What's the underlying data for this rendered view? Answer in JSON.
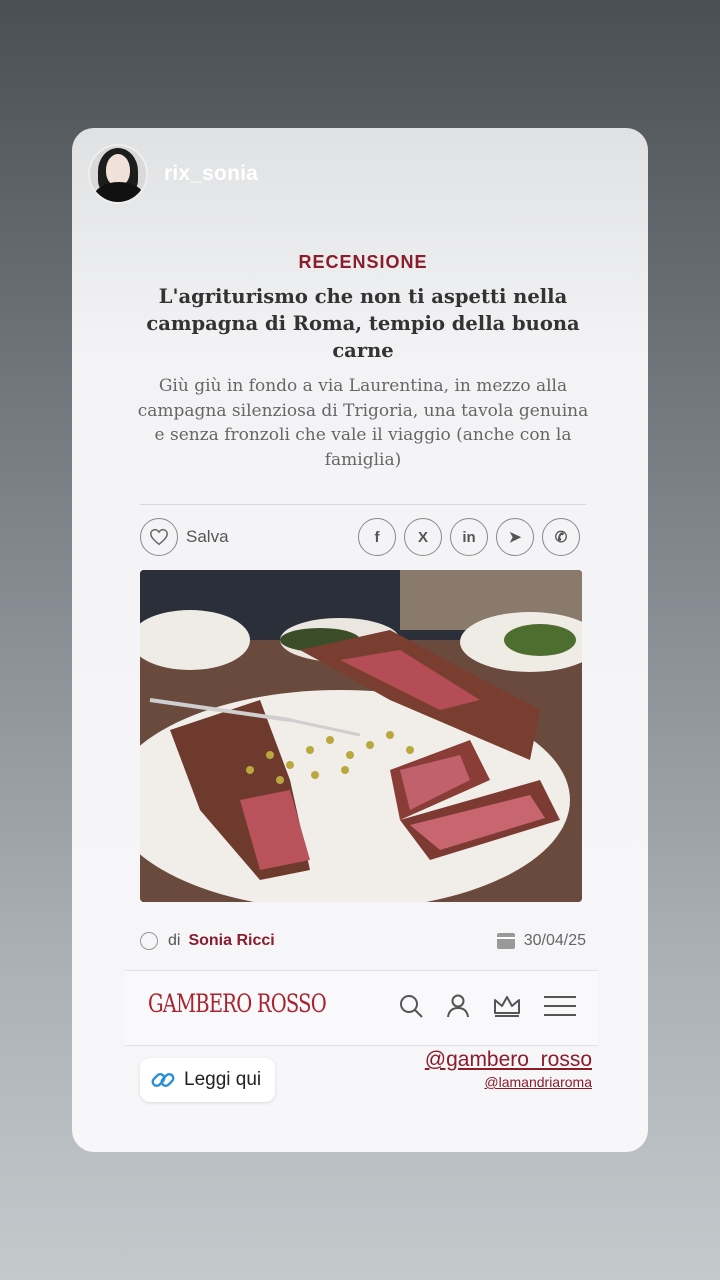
{
  "story": {
    "username": "rix_sonia"
  },
  "article": {
    "kicker": "RECENSIONE",
    "headline": "L'agriturismo che non ti aspetti nella campagna di Roma, tempio della buona carne",
    "subhead": "Giù giù in fondo a via Laurentina, in mezzo alla campagna silenziosa di Trigoria, una tavola genuina e senza fronzoli che vale il viaggio (anche con la famiglia)",
    "save_label": "Salva",
    "share_icons": [
      "facebook-icon",
      "x-icon",
      "linkedin-icon",
      "telegram-icon",
      "whatsapp-icon"
    ],
    "share_glyphs": [
      "f",
      "X",
      "in",
      "➤",
      "✆"
    ],
    "byline_prefix": "di",
    "author": "Sonia Ricci",
    "date": "30/04/25"
  },
  "site": {
    "logo_text": "GAMBERO ROSSO"
  },
  "sticker": {
    "link_label": "Leggi qui",
    "mention_main": "@gambero_rosso",
    "mention_sub": "@lamandriaroma"
  },
  "colors": {
    "brand": "#8b1c2b",
    "logo": "#a8232e"
  }
}
